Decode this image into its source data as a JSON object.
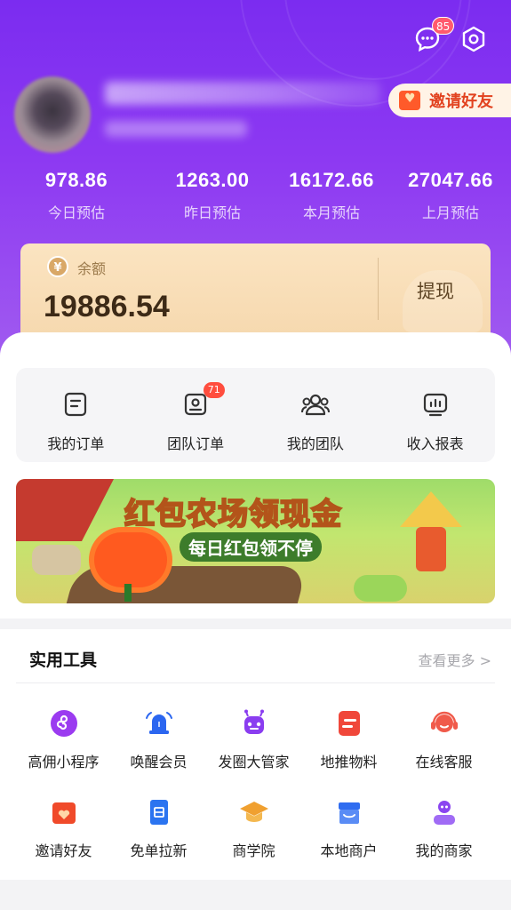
{
  "header": {
    "message_badge": "85",
    "invite_label": "邀请好友"
  },
  "stats": [
    {
      "value": "978.86",
      "label": "今日预估"
    },
    {
      "value": "1263.00",
      "label": "昨日预估"
    },
    {
      "value": "16172.66",
      "label": "本月预估"
    },
    {
      "value": "27047.66",
      "label": "上月预估"
    }
  ],
  "balance": {
    "label": "余额",
    "value": "19886.54",
    "withdraw_label": "提现"
  },
  "quick": [
    {
      "label": "我的订单",
      "icon": "order-icon"
    },
    {
      "label": "团队订单",
      "icon": "team-order-icon",
      "badge": "71"
    },
    {
      "label": "我的团队",
      "icon": "team-icon"
    },
    {
      "label": "收入报表",
      "icon": "report-icon"
    }
  ],
  "banner": {
    "title": "红包农场领现金",
    "subtitle": "每日红包领不停"
  },
  "tools": {
    "title": "实用工具",
    "more": "查看更多 >",
    "row1": [
      {
        "label": "高佣小程序",
        "icon": "mini-program-icon",
        "color": "#9b3bf0"
      },
      {
        "label": "唤醒会员",
        "icon": "bell-icon",
        "color": "#2b66f0"
      },
      {
        "label": "发圈大管家",
        "icon": "robot-icon",
        "color": "#8a3df0"
      },
      {
        "label": "地推物料",
        "icon": "material-icon",
        "color": "#f0473a"
      },
      {
        "label": "在线客服",
        "icon": "headset-icon",
        "color": "#f05a4a"
      }
    ],
    "row2": [
      {
        "label": "邀请好友",
        "icon": "invite-icon",
        "color": "#f04a2a"
      },
      {
        "label": "免单拉新",
        "icon": "free-ticket-icon",
        "color": "#2b74f0"
      },
      {
        "label": "商学院",
        "icon": "graduation-icon",
        "color": "#f0a030"
      },
      {
        "label": "本地商户",
        "icon": "store-icon",
        "color": "#2f6cf0"
      },
      {
        "label": "我的商家",
        "icon": "merchant-icon",
        "color": "#8b45f0"
      }
    ]
  }
}
